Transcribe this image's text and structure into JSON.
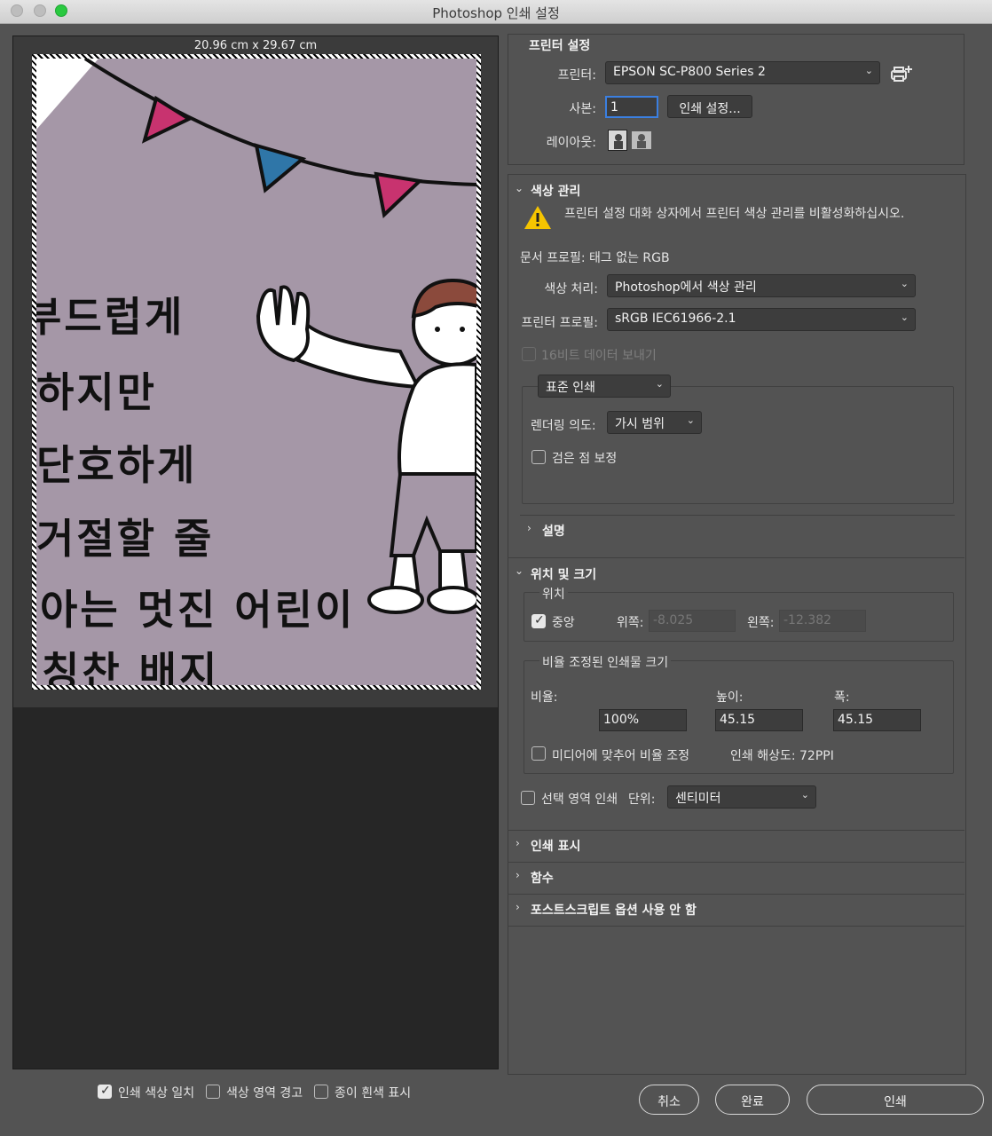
{
  "window": {
    "title": "Photoshop 인쇄 설정"
  },
  "preview": {
    "dimensions": "20.96 cm x 29.67 cm",
    "artwork_lines": [
      "부드럽게",
      "하지만",
      "단호하게",
      "거절할 줄",
      "아는 멋진 어린이",
      "칭찬 배지"
    ],
    "colors": {
      "background": "#a597a7",
      "flag_pink": "#c8336f",
      "flag_blue": "#2f76a8",
      "hair": "#8b4a3c"
    }
  },
  "printer_settings": {
    "title": "프린터 설정",
    "printer_label": "프린터:",
    "printer_value": "EPSON SC-P800 Series 2",
    "copies_label": "사본:",
    "copies_value": "1",
    "print_settings_button": "인쇄 설정...",
    "layout_label": "레이아웃:",
    "icons": [
      "printer-add-icon",
      "portrait-layout-icon",
      "landscape-layout-icon"
    ]
  },
  "color_management": {
    "title": "색상 관리",
    "warning_text": "프린터 설정 대화 상자에서 프린터 색상 관리를 비활성화하십시오.",
    "document_profile": "문서 프로필: 태그 없는 RGB",
    "color_handling_label": "색상 처리:",
    "color_handling_value": "Photoshop에서 색상 관리",
    "printer_profile_label": "프린터 프로필:",
    "printer_profile_value": "sRGB IEC61966-2.1",
    "send_16bit_label": "16비트 데이터 보내기",
    "send_16bit_checked": false,
    "print_mode_value": "표준 인쇄",
    "rendering_intent_label": "렌더링 의도:",
    "rendering_intent_value": "가시 범위",
    "black_point_label": "검은 점 보정",
    "black_point_checked": false
  },
  "description": {
    "title": "설명"
  },
  "position_size": {
    "title": "위치 및 크기",
    "position_legend": "위치",
    "center_label": "중앙",
    "center_checked": true,
    "top_label": "위쪽:",
    "top_value": "-8.025",
    "left_label": "왼쪽:",
    "left_value": "-12.382",
    "scaled_legend": "비율 조정된 인쇄물 크기",
    "scale_label": "비율:",
    "scale_value": "100%",
    "height_label": "높이:",
    "height_value": "45.15",
    "width_label": "폭:",
    "width_value": "45.15",
    "fit_media_label": "미디어에 맞추어 비율 조정",
    "fit_media_checked": false,
    "print_resolution": "인쇄 해상도: 72PPI",
    "print_selection_label": "선택 영역 인쇄",
    "print_selection_checked": false,
    "units_label": "단위:",
    "units_value": "센티미터"
  },
  "collapsed_sections": {
    "print_marks": "인쇄 표시",
    "functions": "함수",
    "postscript": "포스트스크립트 옵션 사용 안 함"
  },
  "bottom": {
    "match_print_colors": "인쇄 색상 일치",
    "match_print_colors_checked": true,
    "gamut_warning": "색상 영역 경고",
    "gamut_warning_checked": false,
    "show_paper_white": "종이 흰색 표시",
    "show_paper_white_checked": false,
    "cancel_button": "취소",
    "done_button": "완료",
    "print_button": "인쇄"
  }
}
